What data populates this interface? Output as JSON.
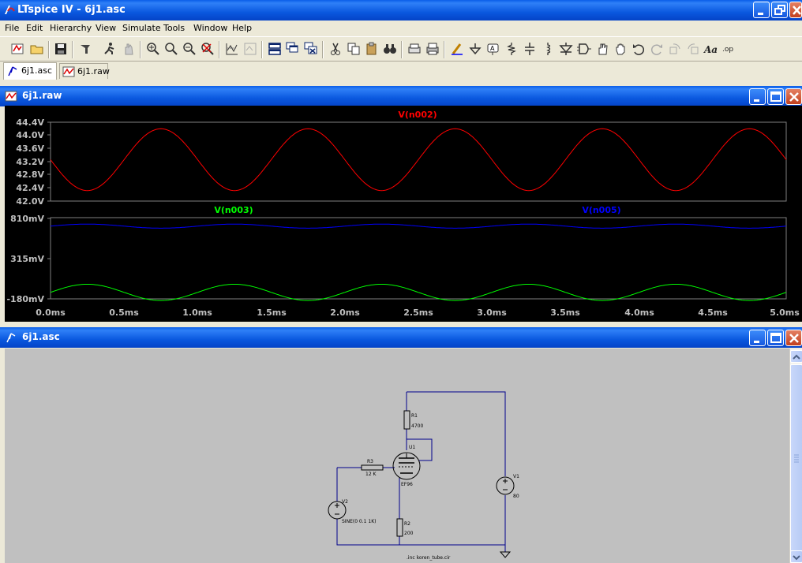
{
  "window": {
    "title": "LTspice IV - 6j1.asc",
    "buttons": {
      "minimize": "minimize",
      "maximize": "restore",
      "close": "close"
    }
  },
  "menu": [
    {
      "label": "File"
    },
    {
      "label": "Edit"
    },
    {
      "label": "Hierarchy"
    },
    {
      "label": "View"
    },
    {
      "label": "Simulate"
    },
    {
      "label": "Tools"
    },
    {
      "label": "Window"
    },
    {
      "label": "Help"
    }
  ],
  "toolbar": [
    "open-schematic-icon",
    "open-file-icon",
    "save-icon",
    "control-panel-icon",
    "run-icon",
    "halt-icon",
    "zoom-in-icon",
    "zoom-pan-icon",
    "zoom-out-icon",
    "zoom-fit-icon",
    "autorange-icon",
    "edit-waveform-icon",
    "tile-horizontal-icon",
    "cascade-icon",
    "close-all-icon",
    "cut-icon",
    "copy-icon",
    "paste-icon",
    "find-icon",
    "print-preview-icon",
    "print-icon",
    "draw-wire-icon",
    "ground-icon",
    "label-net-icon",
    "resistor-icon",
    "capacitor-icon",
    "inductor-icon",
    "diode-icon",
    "component-icon",
    "move-icon",
    "drag-icon",
    "undo-icon",
    "redo-icon",
    "rotate-icon",
    "mirror-icon",
    "text-icon",
    "spice-directive-icon"
  ],
  "tabs": [
    {
      "label": "6j1.asc",
      "icon": "schematic-icon",
      "active": true
    },
    {
      "label": "6j1.raw",
      "icon": "waveform-icon",
      "active": false
    }
  ],
  "waveform_window": {
    "title": "6j1.raw",
    "traces": [
      {
        "name": "V(n002)",
        "color": "#ff0000"
      },
      {
        "name": "V(n003)",
        "color": "#00ff00"
      },
      {
        "name": "V(n005)",
        "color": "#0000ff"
      }
    ],
    "top_pane": {
      "ticks": [
        "44.4V",
        "44.0V",
        "43.6V",
        "43.2V",
        "42.8V",
        "42.4V",
        "42.0V"
      ]
    },
    "bottom_pane": {
      "ticks": [
        "810mV",
        "315mV",
        "-180mV"
      ]
    },
    "x_ticks": [
      "0.0ms",
      "0.5ms",
      "1.0ms",
      "1.5ms",
      "2.0ms",
      "2.5ms",
      "3.0ms",
      "3.5ms",
      "4.0ms",
      "4.5ms",
      "5.0ms"
    ]
  },
  "chart_data": [
    {
      "type": "line",
      "title": "",
      "xlabel": "",
      "ylabel": "",
      "xlim": [
        0,
        5
      ],
      "ylim": [
        42.0,
        44.4
      ],
      "series": [
        {
          "name": "V(n002)",
          "color": "#ff0000",
          "form": "sine",
          "offset": 43.26,
          "amplitude": 0.94,
          "frequency_khz": 1,
          "phase": "starts at mean, decreasing",
          "minimum": 42.32,
          "maximum": 44.2
        }
      ]
    },
    {
      "type": "line",
      "title": "",
      "xlabel": "",
      "ylabel": "",
      "xlim": [
        0,
        5
      ],
      "ylim": [
        -180,
        810
      ],
      "series": [
        {
          "name": "V(n003)",
          "color": "#00ff00",
          "form": "sine",
          "offset": -100,
          "amplitude": 100,
          "frequency_khz": 1,
          "phase": "starts at mean, increasing"
        },
        {
          "name": "V(n005)",
          "color": "#0000ff",
          "form": "sine",
          "offset": 715,
          "amplitude": 25,
          "frequency_khz": 1,
          "phase": "starts at mean, increasing"
        }
      ]
    }
  ],
  "schematic_window": {
    "title": "6j1.asc",
    "labels": {
      "r1_name": "R1",
      "r1_value": "4700",
      "u1_name": "U1",
      "u1_model": "EF96",
      "r3_name": "R3",
      "r3_value": "12 K",
      "r2_name": "R2",
      "r2_value": "200",
      "v1_name": "V1",
      "v1_value": "80",
      "v2_name": "V2",
      "v2_value": "SINE(0 0.1 1K)",
      "directive": ".inc koren_tube.cir"
    }
  },
  "colors": {
    "accent": "#0a5ee8",
    "wire": "#0000a0",
    "plot_bg": "#000000",
    "schematic_bg": "#c0c0c0"
  }
}
